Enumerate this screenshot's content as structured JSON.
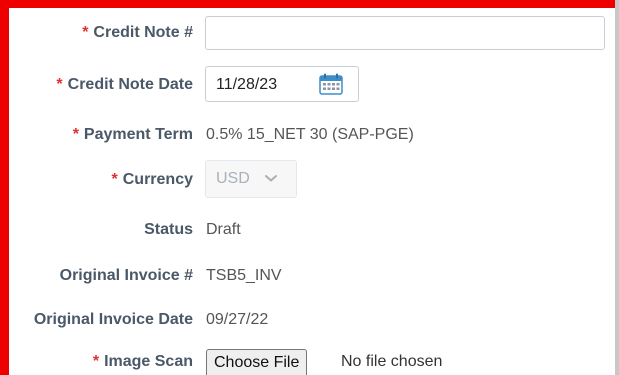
{
  "form": {
    "required_marker": "*",
    "credit_note_number": {
      "label": "Credit Note #",
      "value": "",
      "placeholder": ""
    },
    "credit_note_date": {
      "label": "Credit Note Date",
      "value": "11/28/23"
    },
    "payment_term": {
      "label": "Payment Term",
      "value": "0.5% 15_NET 30 (SAP-PGE)"
    },
    "currency": {
      "label": "Currency",
      "value": "USD"
    },
    "status": {
      "label": "Status",
      "value": "Draft"
    },
    "original_invoice_number": {
      "label": "Original Invoice #",
      "value": "TSB5_INV"
    },
    "original_invoice_date": {
      "label": "Original Invoice Date",
      "value": "09/27/22"
    },
    "image_scan": {
      "label": "Image Scan",
      "button_label": "Choose File",
      "status_text": "No file chosen"
    }
  },
  "icons": {
    "date_picker": "calendar-icon",
    "currency_dropdown": "chevron-down-icon"
  },
  "colors": {
    "highlight_border": "#ee0000",
    "required_asterisk": "#e0302e",
    "label_text": "#4a5868",
    "calendar_accent": "#3e8ecc"
  }
}
